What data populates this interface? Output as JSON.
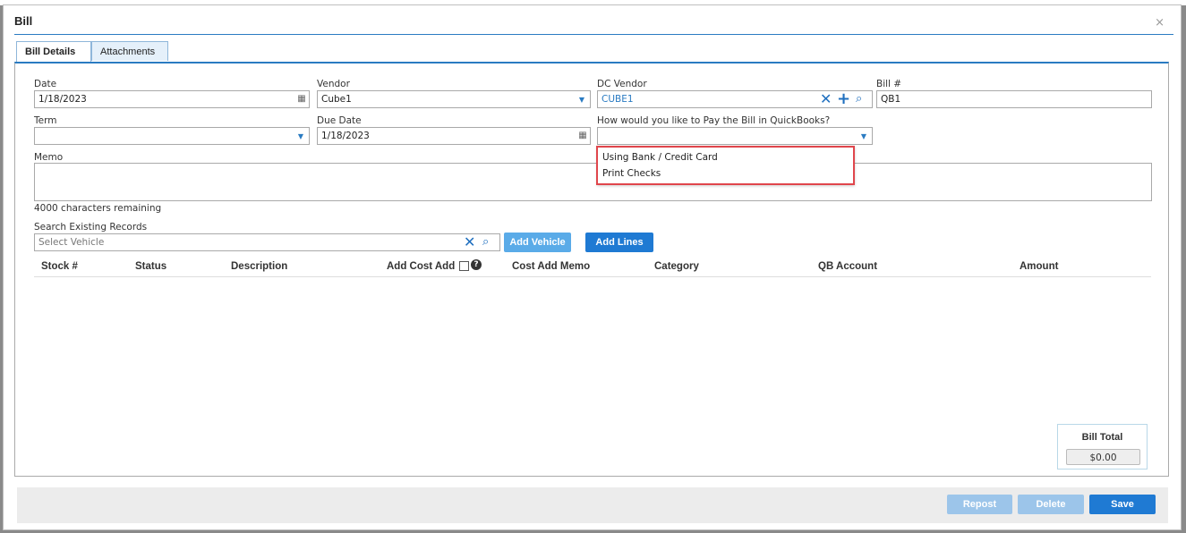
{
  "dialog": {
    "title": "Bill",
    "close_glyph": "×"
  },
  "tabs": [
    {
      "label": "Bill Details",
      "active": true
    },
    {
      "label": "Attachments",
      "active": false
    }
  ],
  "form": {
    "date": {
      "label": "Date",
      "value": "1/18/2023"
    },
    "vendor": {
      "label": "Vendor",
      "value": "Cube1"
    },
    "dc_vendor": {
      "label": "DC Vendor",
      "value": "CUBE1"
    },
    "bill_no": {
      "label": "Bill #",
      "value": "QB1"
    },
    "term": {
      "label": "Term",
      "value": ""
    },
    "due_date": {
      "label": "Due Date",
      "value": "1/18/2023"
    },
    "pay_method": {
      "label": "How would you like to Pay the Bill in QuickBooks?",
      "value": "",
      "options": [
        "Using Bank / Credit Card",
        "Print Checks"
      ]
    },
    "memo": {
      "label": "Memo",
      "value": "",
      "remaining": "4000 characters remaining"
    },
    "search": {
      "label": "Search Existing Records",
      "placeholder": "Select Vehicle"
    }
  },
  "buttons": {
    "add_vehicle": "Add Vehicle",
    "add_lines": "Add Lines",
    "repost": "Repost",
    "delete": "Delete",
    "save": "Save"
  },
  "table": {
    "columns": [
      "Stock #",
      "Status",
      "Description",
      "Add Cost Add",
      "Cost Add Memo",
      "Category",
      "QB Account",
      "Amount"
    ]
  },
  "total": {
    "label": "Bill Total",
    "value": "$0.00"
  },
  "icons": {
    "calendar": "calendar-icon",
    "clear": "x-icon",
    "add": "plus-icon",
    "search": "search-icon",
    "help": "help-icon",
    "caret": "chevron-down-icon"
  },
  "colors": {
    "accent": "#2a7bc2",
    "primary_button": "#1f7ad3",
    "disabled_button": "#9cc5ea",
    "highlight": "#e0464c"
  }
}
